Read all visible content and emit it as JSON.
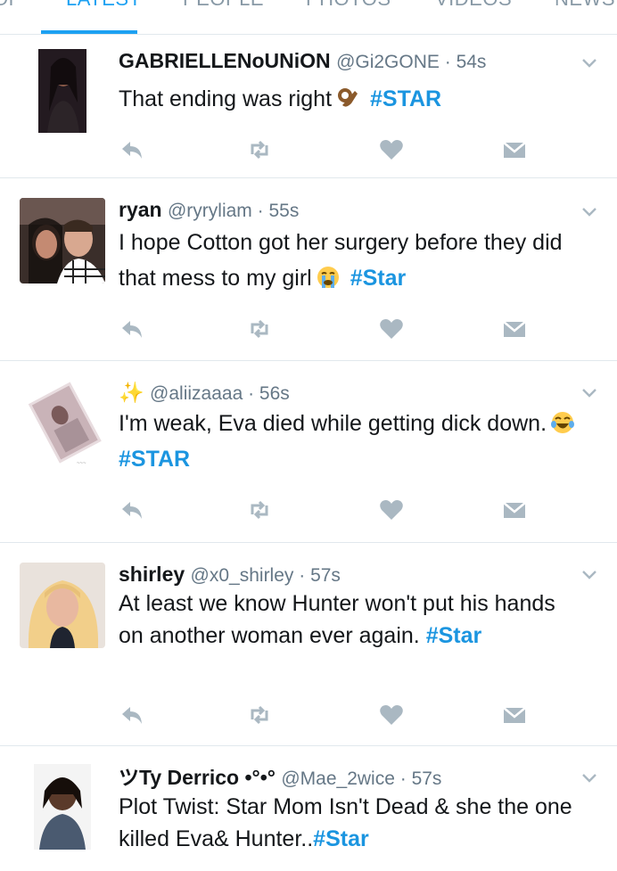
{
  "tabs": [
    {
      "label": "OP"
    },
    {
      "label": "LATEST"
    },
    {
      "label": "PEOPLE"
    },
    {
      "label": "PHOTOS"
    },
    {
      "label": "VIDEOS"
    },
    {
      "label": "NEWS"
    }
  ],
  "active_tab": "LATEST",
  "accent_color": "#1da1f2",
  "hashtag_color": "#1b95e0",
  "tweets": [
    {
      "name": "GABRIELLENoUNiON",
      "handle": "@Gi2GONE",
      "time": "54s",
      "text": "That ending was right",
      "emoji": "ok-hand-emoji",
      "hashtag": "#STAR"
    },
    {
      "name": "ryan",
      "handle": "@ryryliam",
      "time": "55s",
      "text": "I hope Cotton got her surgery before they did that mess to my girl",
      "emoji": "crying-face-emoji",
      "hashtag": "#Star"
    },
    {
      "name": "✨",
      "handle": "@aliizaaaa",
      "time": "56s",
      "text": "I'm weak, Eva died while getting dick down.",
      "emoji": "tears-of-joy-emoji",
      "hashtag": "#STAR"
    },
    {
      "name": "shirley",
      "handle": "@x0_shirley",
      "time": "57s",
      "text": "At least we know Hunter won't put his hands on another woman ever again.",
      "hashtag": "#Star"
    },
    {
      "name": "ツTy Derrico •°•°",
      "handle": "@Mae_2wice",
      "time": "57s",
      "text": "Plot Twist: Star Mom Isn't Dead & she the one killed Eva& Hunter..",
      "hashtag": "#Star"
    }
  ],
  "separator": " · ",
  "icons": [
    "reply-icon",
    "retweet-icon",
    "like-icon",
    "direct-message-icon",
    "chevron-down-icon"
  ]
}
